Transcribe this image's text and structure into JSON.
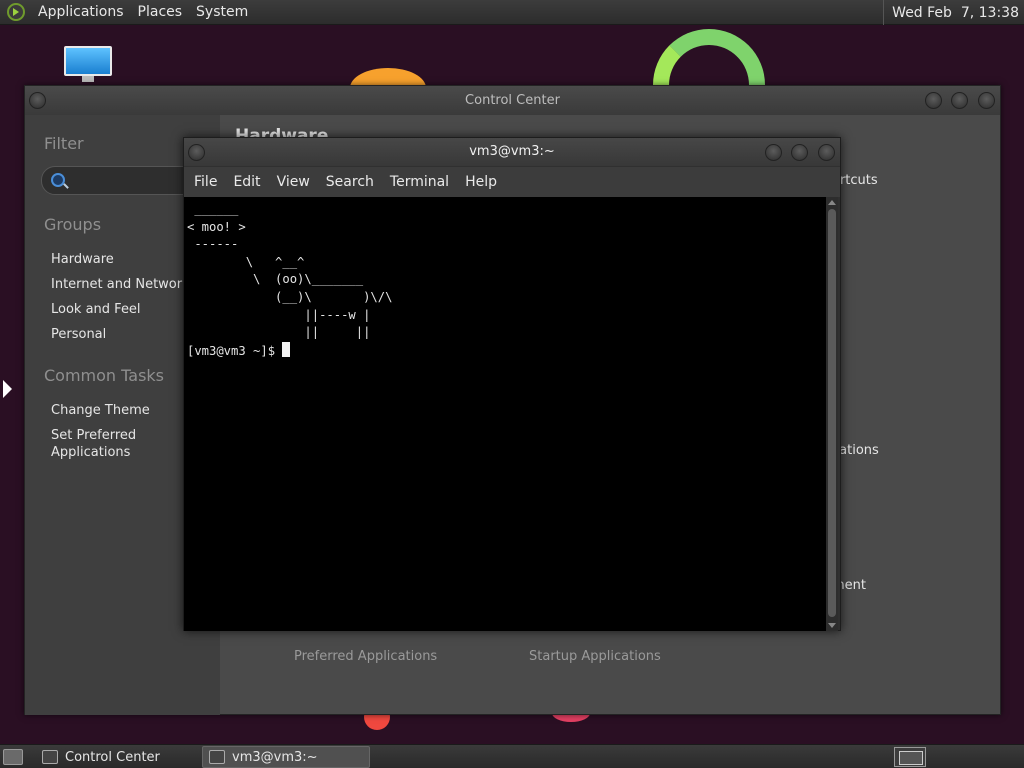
{
  "top_panel": {
    "menus": [
      "Applications",
      "Places",
      "System"
    ],
    "clock": "Wed Feb  7, 13:38"
  },
  "control_center": {
    "title": "Control Center",
    "sidebar": {
      "filter_heading": "Filter",
      "groups_heading": "Groups",
      "groups": [
        "Hardware",
        "Internet and Network",
        "Look and Feel",
        "Personal"
      ],
      "common_tasks_heading": "Common Tasks",
      "tasks": [
        "Change Theme",
        "Set Preferred Applications"
      ]
    },
    "main": {
      "heading": "Hardware",
      "peek_right_1": "ortcuts",
      "peek_right_2": "cations",
      "peek_right_3": "ment",
      "peek_bottom_1": "Preferred Applications",
      "peek_bottom_2": "Startup Applications"
    }
  },
  "terminal": {
    "title": "vm3@vm3:~",
    "menus": [
      "File",
      "Edit",
      "View",
      "Search",
      "Terminal",
      "Help"
    ],
    "output": " ______\n< moo! >\n ------\n        \\   ^__^\n         \\  (oo)\\_______\n            (__)\\       )\\/\\\n                ||----w |\n                ||     ||\n",
    "prompt": "[vm3@vm3 ~]$ "
  },
  "taskbar": {
    "tasks": [
      "Control Center",
      "vm3@vm3:~"
    ]
  },
  "colors": {
    "desktop_bg": "#2a0f23",
    "panel": "#333333",
    "terminal_bg": "#000000"
  }
}
